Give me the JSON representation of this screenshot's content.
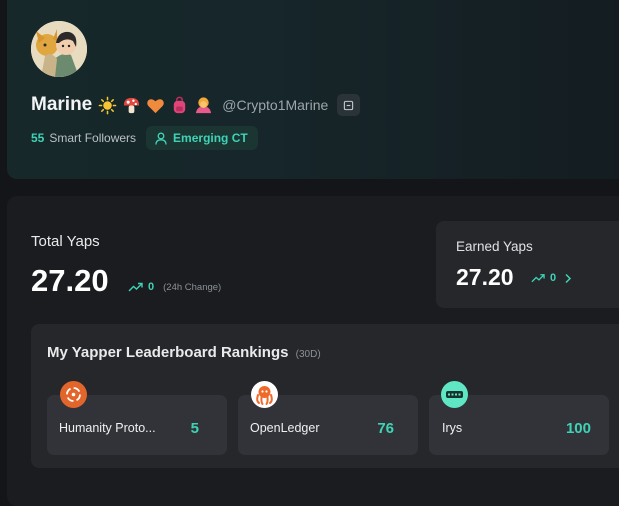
{
  "profile": {
    "name": "Marine",
    "handle": "@Crypto1Marine",
    "emojis": [
      "sun-emoji",
      "mushroom-emoji",
      "orange-heart-emoji",
      "backpack-emoji",
      "person-bowing-emoji"
    ],
    "smart_followers_count": "55",
    "smart_followers_label": "Smart Followers",
    "badge_label": "Emerging CT"
  },
  "total_yaps": {
    "title": "Total Yaps",
    "value": "27.20",
    "change": "0",
    "change_label": "(24h Change)"
  },
  "earned_yaps": {
    "title": "Earned Yaps",
    "value": "27.20",
    "change": "0"
  },
  "leaderboard": {
    "title": "My Yapper Leaderboard Rankings",
    "period": "(30D)",
    "items": [
      {
        "name": "Humanity Proto...",
        "rank": "5",
        "logo": "humanity-protocol-logo-icon"
      },
      {
        "name": "OpenLedger",
        "rank": "76",
        "logo": "openledger-octopus-logo-icon"
      },
      {
        "name": "Irys",
        "rank": "100",
        "logo": "irys-logo-icon"
      }
    ]
  },
  "colors": {
    "accent": "#3fd3b6",
    "background": "#141518",
    "panel": "#1b1c20",
    "card": "#25272b"
  }
}
